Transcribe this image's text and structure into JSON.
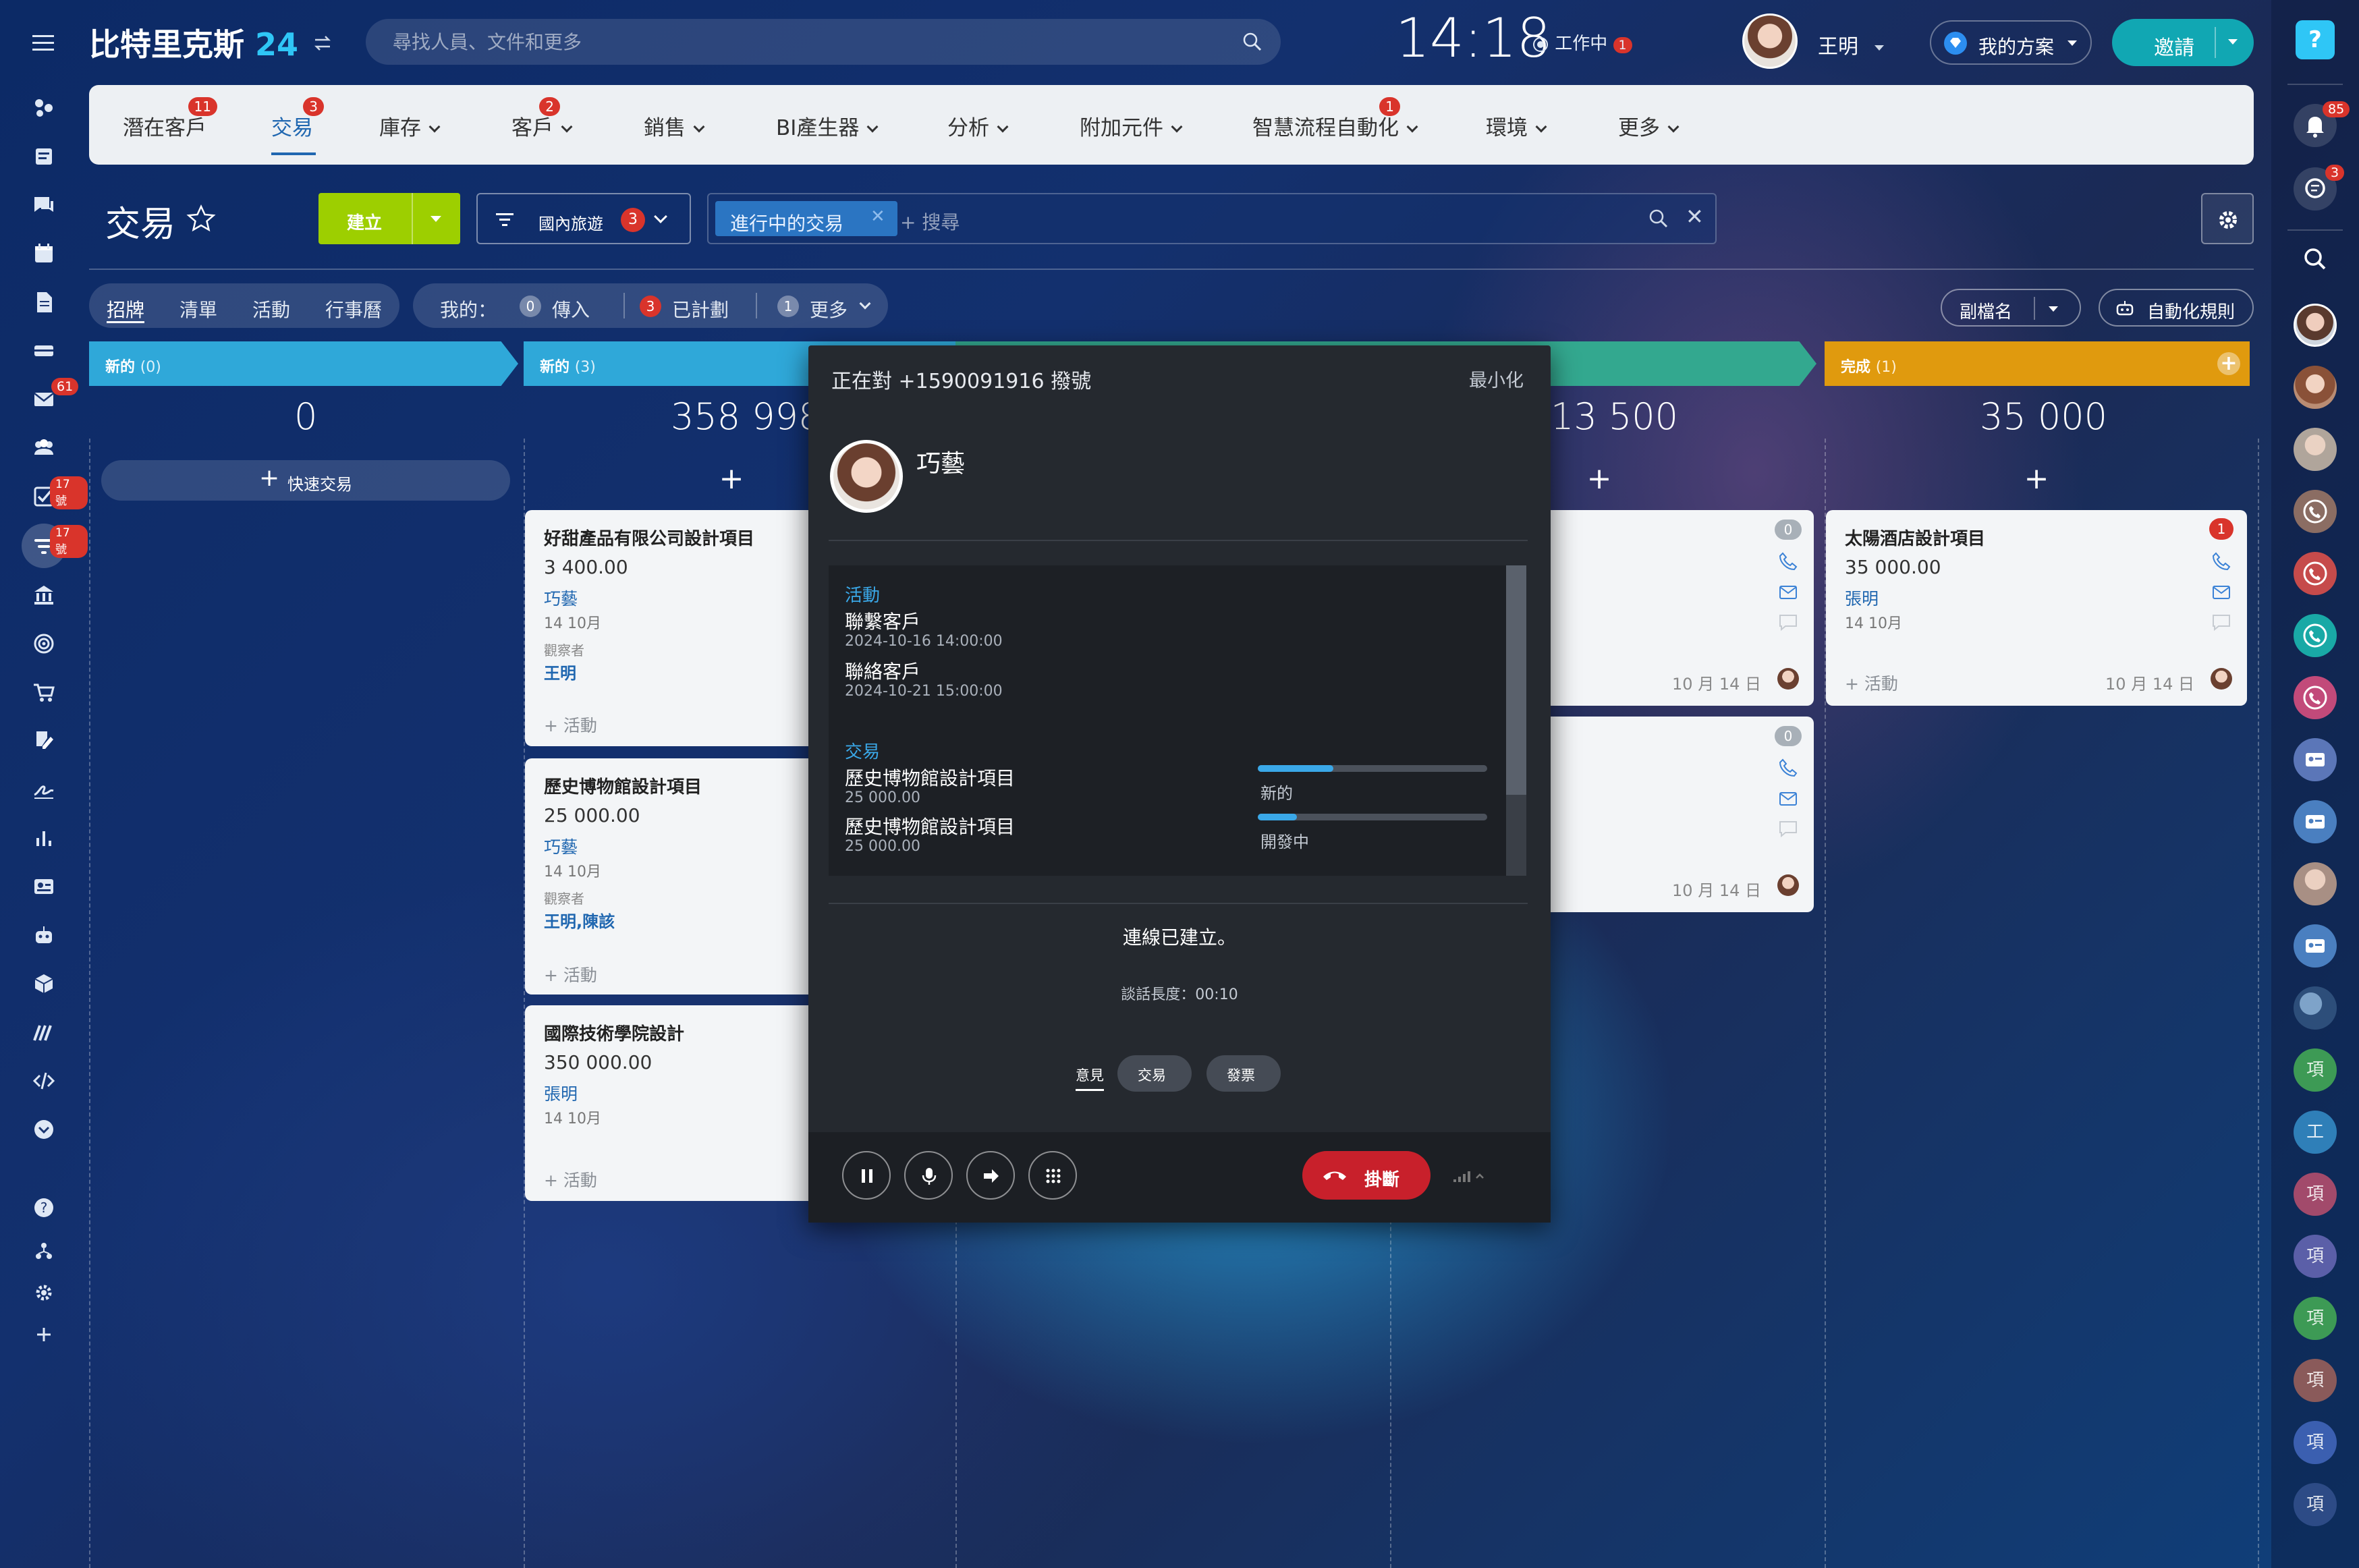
{
  "app": {
    "title": "比特里克斯",
    "title_num": "24",
    "clock": "14:18",
    "work_status": "工作中",
    "work_badge": "1"
  },
  "search": {
    "placeholder": "尋找人員、文件和更多"
  },
  "user": {
    "name": "王明"
  },
  "plan": {
    "label": "我的方案"
  },
  "invite": {
    "label": "邀請"
  },
  "left_rail_badges": {
    "mail": "61",
    "tasks": "17 號",
    "crm": "17 號"
  },
  "nav": {
    "items": [
      {
        "label": "潛在客戶",
        "badge": "11"
      },
      {
        "label": "交易",
        "badge": "3"
      },
      {
        "label": "庫存"
      },
      {
        "label": "客戶",
        "badge": "2"
      },
      {
        "label": "銷售"
      },
      {
        "label": "BI產生器"
      },
      {
        "label": "分析"
      },
      {
        "label": "附加元件"
      },
      {
        "label": "智慧流程自動化",
        "badge": "1"
      },
      {
        "label": "環境"
      },
      {
        "label": "更多"
      }
    ]
  },
  "toolbar": {
    "page_title": "交易",
    "create_label": "建立",
    "filter_label": "國內旅遊",
    "filter_count": "3",
    "active_filter": "進行中的交易",
    "search_placeholder": "+ 搜尋"
  },
  "view_tabs": [
    "招牌",
    "清單",
    "活動",
    "行事曆"
  ],
  "my_filter": {
    "label": "我的：",
    "items": [
      {
        "count": "0",
        "label": "傳入"
      },
      {
        "count": "3",
        "label": "已計劃"
      },
      {
        "count": "1",
        "label": "更多"
      }
    ]
  },
  "field_name_label": "副檔名",
  "automation_label": "自動化規則",
  "stages": [
    {
      "name": "新的",
      "count": "(0)",
      "total": "0",
      "color": "#2fa8d9"
    },
    {
      "name": "新的",
      "count": "(3)",
      "total": "358 998",
      "color": "#2fa8d9"
    },
    {
      "name": "",
      "count": "",
      "total": "",
      "color": "#2fa8d9"
    },
    {
      "name": "",
      "count": "",
      "total": "13 500",
      "color": "#33a88f"
    },
    {
      "name": "完成",
      "count": "(1)",
      "total": "35 000",
      "color": "#e09a0e"
    }
  ],
  "quick_deal": "快速交易",
  "cards_col2": [
    {
      "title": "好甜產品有限公司設計項目",
      "amount": "3 400.00",
      "client": "巧藝",
      "date": "14 10月",
      "observer_label": "觀察者",
      "observer": "王明",
      "activity": "+ 活動"
    },
    {
      "title": "歷史博物館設計項目",
      "amount": "25 000.00",
      "client": "巧藝",
      "date": "14 10月",
      "observer_label": "觀察者",
      "observer": "王明,陳該",
      "activity": "+ 活動"
    },
    {
      "title": "國際技術學院設計",
      "amount": "350 000.00",
      "client": "張明",
      "date": "14 10月",
      "activity": "+ 活動"
    }
  ],
  "cards_col4": [
    {
      "badge": "0",
      "date_right": "10 月 14 日"
    },
    {
      "badge": "0",
      "date_right": "10 月 14 日"
    }
  ],
  "card_col5": {
    "title": "太陽酒店設計項目",
    "amount": "35 000.00",
    "client": "張明",
    "date": "14 10月",
    "activity": "+ 活動",
    "date_right": "10 月 14 日",
    "badge": "1"
  },
  "call": {
    "header": "正在對 +1590091916 撥號",
    "minimize": "最小化",
    "contact_name": "巧藝",
    "activities_label": "活動",
    "activities": [
      {
        "title": "聯繫客戶",
        "time": "2024-10-16 14:00:00"
      },
      {
        "title": "聯絡客戶",
        "time": "2024-10-21 15:00:00"
      }
    ],
    "deals_label": "交易",
    "deals": [
      {
        "title": "歷史博物館設計項目",
        "amount": "25 000.00",
        "stage": "新的",
        "progress": 0.33
      },
      {
        "title": "歷史博物館設計項目",
        "amount": "25 000.00",
        "stage": "開發中",
        "progress": 0.17
      }
    ],
    "status": "連線已建立。",
    "duration": "談話長度：00:10",
    "tabs": [
      "意見",
      "交易",
      "發票"
    ],
    "hangup": "掛斷"
  },
  "right_rail": {
    "notif_badge": "85",
    "chat_badge": "3",
    "letters": [
      "項",
      "工",
      "項",
      "項",
      "項",
      "項",
      "項",
      "項"
    ]
  }
}
